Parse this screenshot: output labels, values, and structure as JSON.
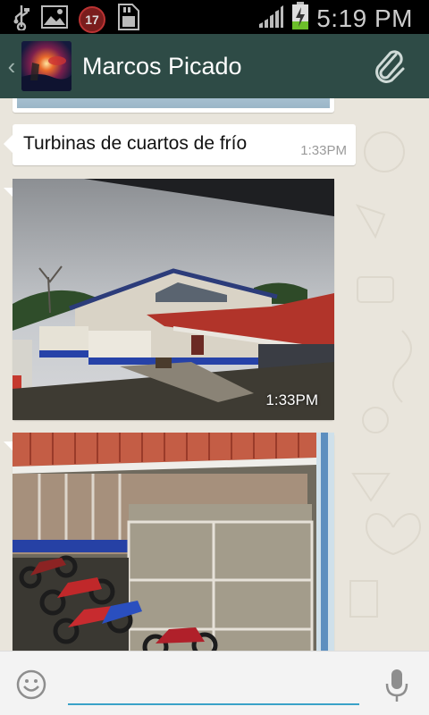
{
  "status_bar": {
    "notification_badge": "17",
    "time": "5:19 PM",
    "icons": [
      "usb-icon",
      "image-icon",
      "calendar-badge-icon",
      "sd-card-icon",
      "signal-icon",
      "battery-charging-icon"
    ]
  },
  "header": {
    "contact_name": "Marcos Picado",
    "icons": [
      "back-chevron-icon",
      "contact-avatar",
      "paperclip-attach-icon"
    ]
  },
  "messages": [
    {
      "type": "image",
      "partial": true
    },
    {
      "type": "text",
      "text": "Turbinas de cuartos de frío",
      "time": "1:33PM"
    },
    {
      "type": "image",
      "time": "1:33PM"
    },
    {
      "type": "image",
      "partial": true
    }
  ],
  "composer": {
    "input_value": "",
    "placeholder": "",
    "icons": [
      "emoji-icon",
      "microphone-icon"
    ]
  },
  "colors": {
    "header_bg": "#2e4b46",
    "chat_bg": "#e9e5dc",
    "input_underline": "#3aa2c8"
  }
}
